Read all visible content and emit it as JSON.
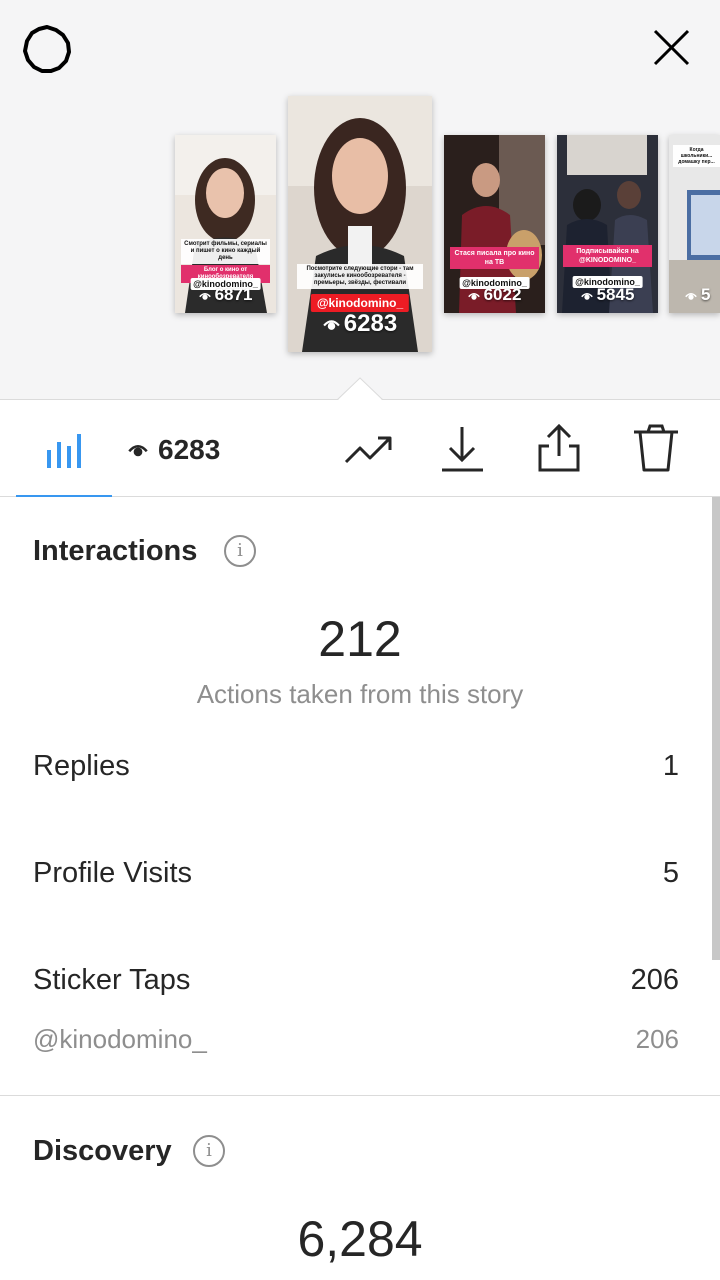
{
  "stories": [
    {
      "views": "6871",
      "caption_a": "Смотрит фильмы, сериалы и пишет о кино каждый день",
      "caption_b": "Блог о кино от кинообозревателя",
      "mention": "@kinodomino_"
    },
    {
      "views": "6283",
      "caption_a": "Посмотрите следующие стори - там закулисье кинообозревателя - премьеры, звёзды, фестивали",
      "mention": "@kinodomino_"
    },
    {
      "views": "6022",
      "caption_a": "Стася писала про кино на ТВ",
      "mention": "@kinodomino_"
    },
    {
      "views": "5845",
      "caption_a": "Подписывайся на @KINODOMINO_",
      "mention": "@kinodomino_"
    },
    {
      "views": "5",
      "caption_a": "Когда школьники... домашку пер..."
    }
  ],
  "tabbar": {
    "views": "6283"
  },
  "interactions": {
    "title": "Interactions",
    "total": "212",
    "total_label": "Actions taken from this story",
    "rows": [
      {
        "label": "Replies",
        "value": "1"
      },
      {
        "label": "Profile Visits",
        "value": "5"
      },
      {
        "label": "Sticker Taps",
        "value": "206"
      }
    ],
    "sticker_detail": {
      "label": "@kinodomino_",
      "value": "206"
    }
  },
  "discovery": {
    "title": "Discovery",
    "total": "6,284"
  },
  "icons": {
    "settings": "settings-gear-icon",
    "close": "close-icon",
    "insights": "bar-chart-icon",
    "eye": "eye-icon",
    "promote": "trending-up-icon",
    "download": "download-icon",
    "share": "share-icon",
    "delete": "trash-icon",
    "info": "info-icon"
  },
  "colors": {
    "accent": "#3897f0",
    "mention_red": "#ed1c24",
    "muted_text": "#8e8e8e"
  }
}
